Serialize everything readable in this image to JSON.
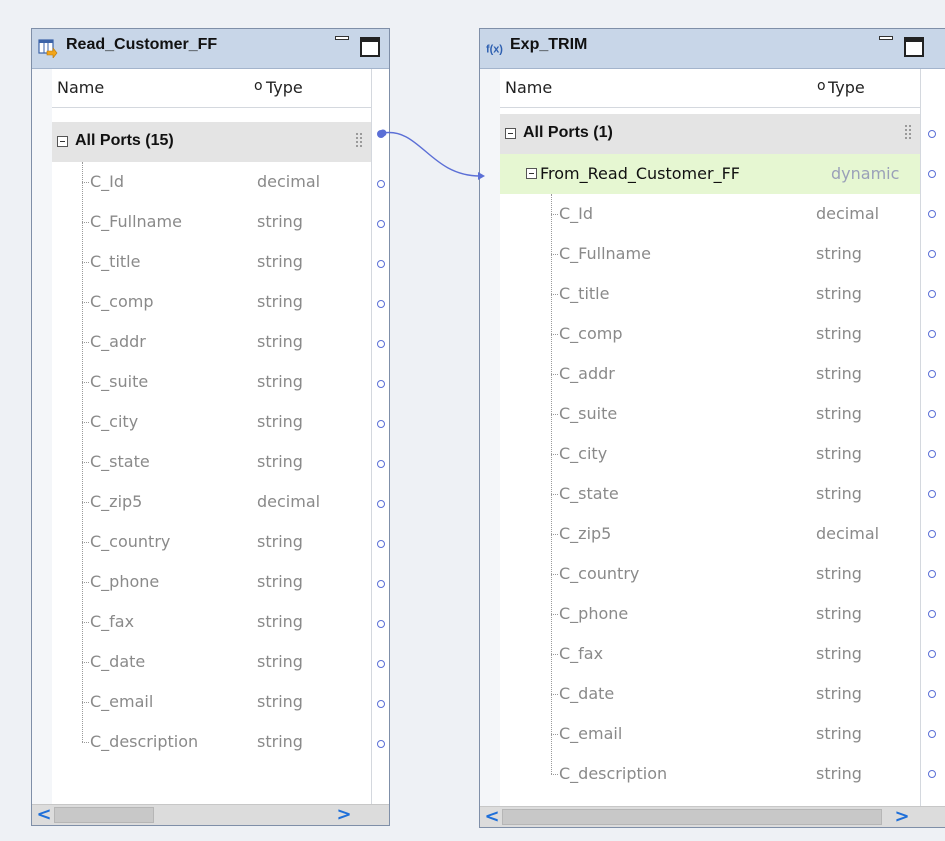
{
  "left_panel": {
    "title": "Read_Customer_FF",
    "icon": "flat-file-read-icon",
    "header": {
      "name": "Name",
      "type": "Type"
    },
    "group": {
      "label": "All Ports (15)"
    },
    "ports": [
      {
        "name": "C_Id",
        "type": "decimal"
      },
      {
        "name": "C_Fullname",
        "type": "string"
      },
      {
        "name": "C_title",
        "type": "string"
      },
      {
        "name": "C_comp",
        "type": "string"
      },
      {
        "name": "C_addr",
        "type": "string"
      },
      {
        "name": "C_suite",
        "type": "string"
      },
      {
        "name": "C_city",
        "type": "string"
      },
      {
        "name": "C_state",
        "type": "string"
      },
      {
        "name": "C_zip5",
        "type": "decimal"
      },
      {
        "name": "C_country",
        "type": "string"
      },
      {
        "name": "C_phone",
        "type": "string"
      },
      {
        "name": "C_fax",
        "type": "string"
      },
      {
        "name": "C_date",
        "type": "string"
      },
      {
        "name": "C_email",
        "type": "string"
      },
      {
        "name": "C_description",
        "type": "string"
      }
    ]
  },
  "right_panel": {
    "title": "Exp_TRIM",
    "icon": "expression-icon",
    "icon_text": "f(x)",
    "header": {
      "name": "Name",
      "type": "Type"
    },
    "group": {
      "label": "All Ports (1)"
    },
    "dynamic_group": {
      "name": "From_Read_Customer_FF",
      "type": "dynamic"
    },
    "ports": [
      {
        "name": "C_Id",
        "type": "decimal"
      },
      {
        "name": "C_Fullname",
        "type": "string"
      },
      {
        "name": "C_title",
        "type": "string"
      },
      {
        "name": "C_comp",
        "type": "string"
      },
      {
        "name": "C_addr",
        "type": "string"
      },
      {
        "name": "C_suite",
        "type": "string"
      },
      {
        "name": "C_city",
        "type": "string"
      },
      {
        "name": "C_state",
        "type": "string"
      },
      {
        "name": "C_zip5",
        "type": "decimal"
      },
      {
        "name": "C_country",
        "type": "string"
      },
      {
        "name": "C_phone",
        "type": "string"
      },
      {
        "name": "C_fax",
        "type": "string"
      },
      {
        "name": "C_date",
        "type": "string"
      },
      {
        "name": "C_email",
        "type": "string"
      },
      {
        "name": "C_description",
        "type": "string"
      }
    ]
  },
  "scroll": {
    "left_arrow": "<",
    "right_arrow": ">"
  },
  "colors": {
    "link": "#5b6fd6",
    "titlebar": "#c8d6e8",
    "highlight": "#e6f7d2"
  }
}
